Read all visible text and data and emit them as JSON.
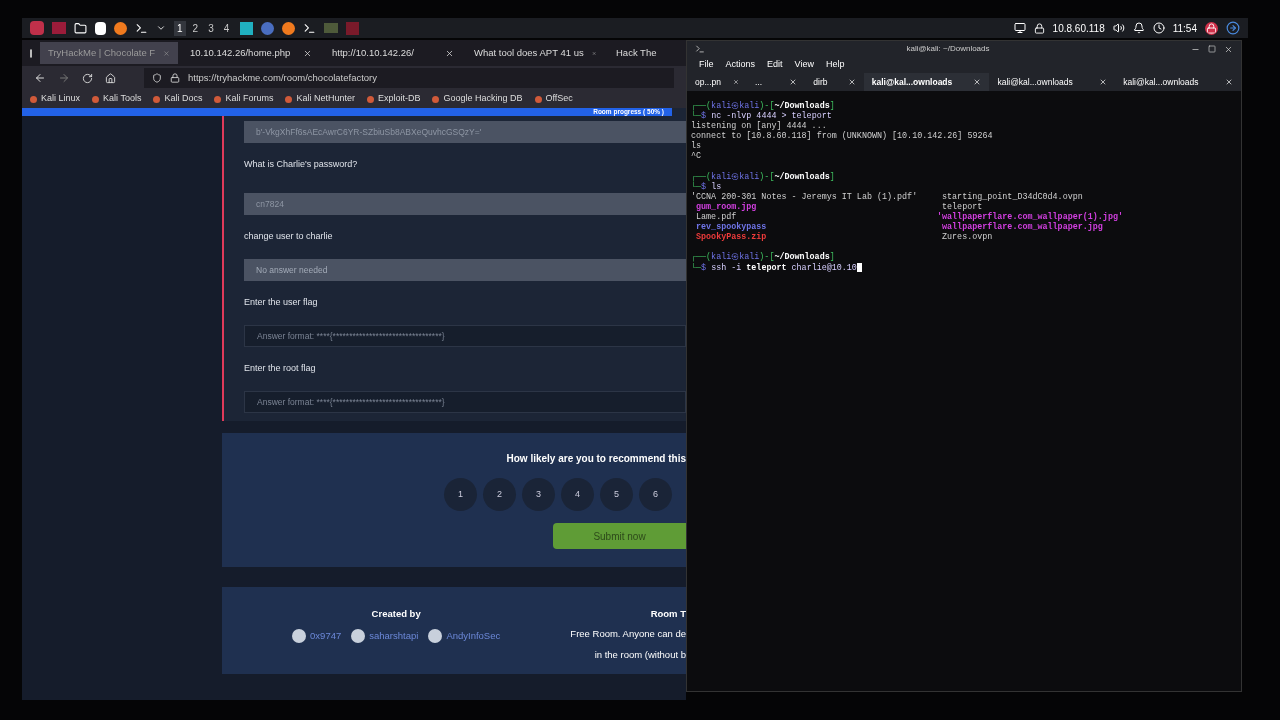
{
  "taskbar": {
    "workspaces": [
      {
        "label": "1",
        "selected": true
      },
      {
        "label": "2",
        "selected": false
      },
      {
        "label": "3",
        "selected": false
      },
      {
        "label": "4",
        "selected": false
      }
    ],
    "ip": "10.8.60.118",
    "clock": "11:54"
  },
  "browser": {
    "tabs": [
      {
        "label": "TryHackMe | Chocolate F",
        "selected": true
      },
      {
        "label": "10.10.142.26/home.php",
        "selected": false
      },
      {
        "label": "http://10.10.142.26/",
        "selected": false
      },
      {
        "label": "What tool does APT 41 us",
        "selected": false
      },
      {
        "label": "Hack The",
        "selected": false
      }
    ],
    "url": "https://tryhackme.com/room/chocolatefactory",
    "bookmarks": [
      "Kali Linux",
      "Kali Tools",
      "Kali Docs",
      "Kali Forums",
      "Kali NetHunter",
      "Exploit-DB",
      "Google Hacking DB",
      "OffSec"
    ],
    "progress": {
      "label": "Room progress ( 50% )",
      "level": 0.5
    },
    "questions": [
      {
        "kind": "answered",
        "value": "b'-VkgXhFf6sAEcAwrC6YR-SZbiuSb8ABXeQuvhcGSQzY='"
      },
      {
        "kind": "answered",
        "label": "What is Charlie's password?",
        "value": "cn7824"
      },
      {
        "kind": "noanswer",
        "label": "change user to charlie",
        "placeholder": "No answer needed"
      },
      {
        "kind": "open",
        "label": "Enter the user flag",
        "placeholder": "Answer format: ****{*********************************}"
      },
      {
        "kind": "open",
        "label": "Enter the root flag",
        "placeholder": "Answer format: ****{*********************************}"
      }
    ],
    "rating": {
      "question": "How likely are you to recommend this",
      "options": [
        "1",
        "2",
        "3",
        "4",
        "5",
        "6"
      ],
      "submit": "Submit now"
    },
    "creators": {
      "heading": "Created by",
      "names": [
        "0x9747",
        "saharshtapi",
        "AndyInfoSec"
      ]
    },
    "room_type": {
      "heading": "Room T",
      "lines": [
        "Free Room. Anyone can de",
        "in the room (without b"
      ]
    }
  },
  "terminal": {
    "title": "kali@kali: ~/Downloads",
    "menu": [
      "File",
      "Actions",
      "Edit",
      "View",
      "Help"
    ],
    "tabs": [
      {
        "label": "op...pn",
        "selected": false
      },
      {
        "label": "...",
        "selected": false
      },
      {
        "label": "dirb",
        "selected": false
      },
      {
        "label": "kali@kal...ownloads",
        "selected": true
      },
      {
        "label": "kali@kal...ownloads",
        "selected": false
      },
      {
        "label": "kali@kal...ownloads",
        "selected": false
      }
    ],
    "lines": [
      {
        "kind": "text",
        "segments": [
          {
            "kind": "frame",
            "text": "┌──("
          },
          {
            "kind": "user",
            "text": "kali㉿kali"
          },
          {
            "kind": "frame",
            "text": ")-["
          },
          {
            "kind": "path",
            "text": "~/Downloads"
          },
          {
            "kind": "frame",
            "text": "]"
          }
        ]
      },
      {
        "kind": "text",
        "segments": [
          {
            "kind": "frame",
            "text": "└─"
          },
          {
            "kind": "user",
            "text": "$ "
          },
          {
            "kind": "command",
            "text": "nc -nlvp 4444 > teleport"
          }
        ]
      },
      {
        "kind": "text",
        "segments": [
          {
            "kind": "plain",
            "text": "listening on [any] 4444 ..."
          }
        ]
      },
      {
        "kind": "text",
        "segments": [
          {
            "kind": "plain",
            "text": "connect to [10.8.60.118] from (UNKNOWN) [10.10.142.26] 59264"
          }
        ]
      },
      {
        "kind": "text",
        "segments": [
          {
            "kind": "plain",
            "text": "ls"
          }
        ]
      },
      {
        "kind": "text",
        "segments": [
          {
            "kind": "plain",
            "text": "^C"
          }
        ]
      },
      {
        "kind": "blank"
      },
      {
        "kind": "text",
        "segments": [
          {
            "kind": "frame",
            "text": "┌──("
          },
          {
            "kind": "user",
            "text": "kali㉿kali"
          },
          {
            "kind": "frame",
            "text": ")-["
          },
          {
            "kind": "path",
            "text": "~/Downloads"
          },
          {
            "kind": "frame",
            "text": "]"
          }
        ]
      },
      {
        "kind": "text",
        "segments": [
          {
            "kind": "frame",
            "text": "└─"
          },
          {
            "kind": "user",
            "text": "$ "
          },
          {
            "kind": "command",
            "text": "ls"
          }
        ]
      },
      {
        "kind": "listing",
        "items": [
          {
            "kind": "file",
            "text": "'CCNA 200-301 Notes - Jeremys IT Lab (1).pdf'"
          },
          {
            "kind": "file",
            "text": " starting_point_D34dC0d4.ovpn"
          },
          {
            "kind": "image",
            "text": " gum_room.jpg"
          },
          {
            "kind": "file",
            "text": " teleport"
          },
          {
            "kind": "file",
            "text": " Lame.pdf"
          },
          {
            "kind": "image",
            "text": "'wallpaperflare.com_wallpaper(1).jpg'"
          },
          {
            "kind": "executable",
            "text": " rev_spookypass"
          },
          {
            "kind": "image",
            "text": " wallpaperflare.com_wallpaper.jpg"
          },
          {
            "kind": "archive",
            "text": " SpookyPass.zip"
          },
          {
            "kind": "file",
            "text": " Zures.ovpn"
          }
        ]
      },
      {
        "kind": "blank"
      },
      {
        "kind": "text",
        "segments": [
          {
            "kind": "frame",
            "text": "┌──("
          },
          {
            "kind": "user",
            "text": "kali㉿kali"
          },
          {
            "kind": "frame",
            "text": ")-["
          },
          {
            "kind": "path",
            "text": "~/Downloads"
          },
          {
            "kind": "frame",
            "text": "]"
          }
        ]
      },
      {
        "kind": "input",
        "segments": [
          {
            "kind": "frame",
            "text": "└─"
          },
          {
            "kind": "user",
            "text": "$ "
          },
          {
            "kind": "command",
            "text": "ssh -i "
          },
          {
            "kind": "bold",
            "text": "teleport"
          },
          {
            "kind": "command",
            "text": " charlie@10.10"
          }
        ]
      }
    ]
  }
}
